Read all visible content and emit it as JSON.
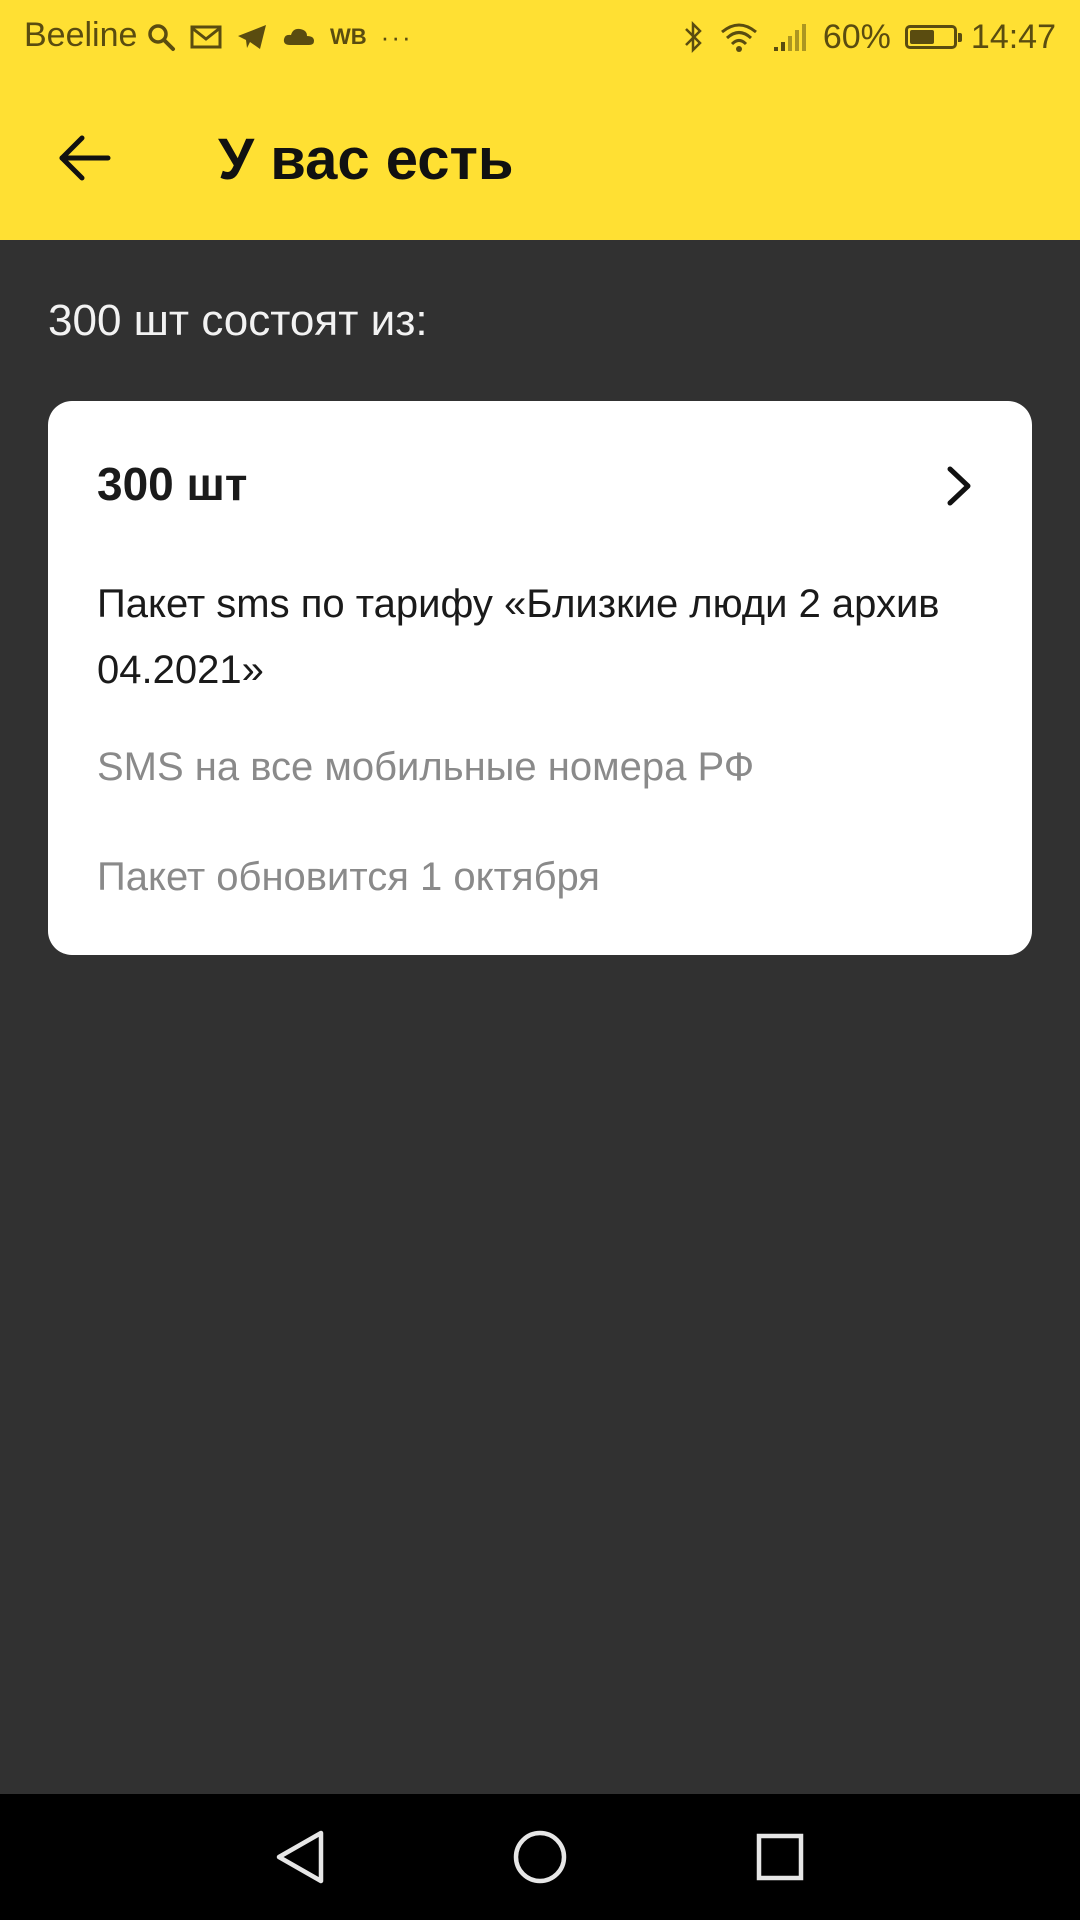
{
  "status_bar": {
    "carrier": "Beeline",
    "notification_icons": [
      "search-icon",
      "mail-icon",
      "telegram-icon",
      "cloud-icon"
    ],
    "wb_label": "WB",
    "more_label": "···",
    "battery_percent": "60%",
    "battery_level": 0.6,
    "time": "14:47"
  },
  "app_bar": {
    "title": "У вас есть"
  },
  "content": {
    "section_title": "300 шт состоят из:",
    "card": {
      "amount": "300 шт",
      "name": "Пакет sms по тарифу «Близкие люди 2 архив 04.2021»",
      "description": "SMS на все мобильные номера РФ",
      "renewal": "Пакет обновится 1 октября"
    }
  },
  "colors": {
    "brand_yellow": "#FFE033",
    "background": "#313131",
    "card": "#FFFFFF",
    "secondary_text": "#8A8A8A"
  }
}
